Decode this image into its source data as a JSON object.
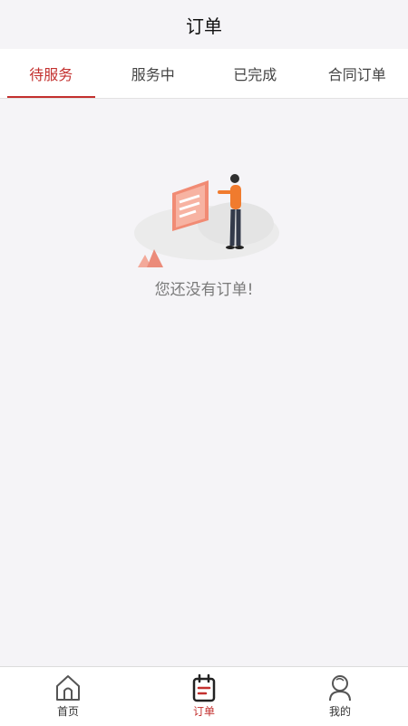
{
  "header": {
    "title": "订单"
  },
  "tabs": [
    {
      "label": "待服务",
      "active": true
    },
    {
      "label": "服务中",
      "active": false
    },
    {
      "label": "已完成",
      "active": false
    },
    {
      "label": "合同订单",
      "active": false
    }
  ],
  "empty_state": {
    "message": "您还没有订单!",
    "illustration": "person-presenting-document-icon"
  },
  "bottom_nav": [
    {
      "label": "首页",
      "icon": "home-icon",
      "active": false
    },
    {
      "label": "订单",
      "icon": "calendar-order-icon",
      "active": true
    },
    {
      "label": "我的",
      "icon": "user-icon",
      "active": false
    }
  ],
  "colors": {
    "accent": "#c3302e",
    "background": "#f5f4f7",
    "person_shirt": "#f07b2e"
  }
}
